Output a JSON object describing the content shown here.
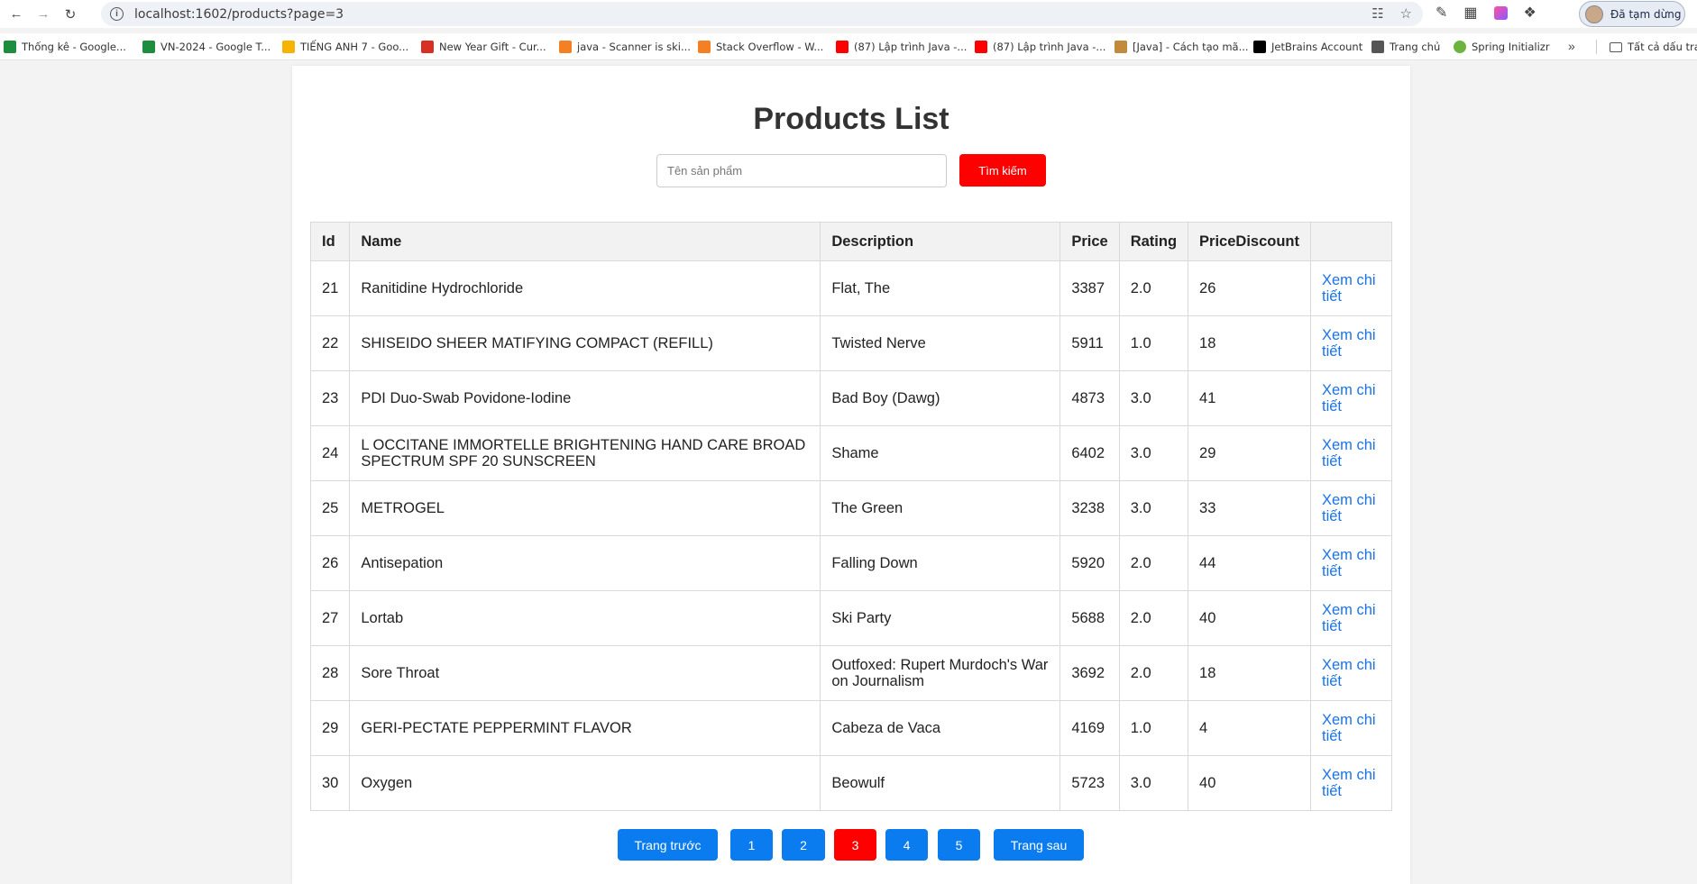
{
  "browser": {
    "url": "localhost:1602/products?page=3",
    "profile_label": "Đã tạm dừng",
    "bookmarks": [
      {
        "label": "Thống kê - Google...",
        "color": "#1e8e3e"
      },
      {
        "label": "VN-2024 - Google T...",
        "color": "#1e8e3e"
      },
      {
        "label": "TIẾNG ANH 7 - Goo...",
        "color": "#f4b400"
      },
      {
        "label": "New Year Gift - Cur...",
        "color": "#d93025"
      },
      {
        "label": "java - Scanner is ski...",
        "color": "#f48024"
      },
      {
        "label": "Stack Overflow - W...",
        "color": "#f48024"
      },
      {
        "label": "(87) Lập trình Java -...",
        "color": "#ff0000"
      },
      {
        "label": "(87) Lập trình Java -...",
        "color": "#ff0000"
      },
      {
        "label": "[Java] - Cách tạo mã...",
        "color": "#c28a3c"
      },
      {
        "label": "JetBrains Account",
        "color": "#000000"
      },
      {
        "label": "Trang chủ",
        "color": "#555555"
      },
      {
        "label": "Spring Initializr",
        "color": "#6db33f"
      }
    ],
    "folder_label": "Tất cả dấu tra"
  },
  "page": {
    "title": "Products List",
    "search_placeholder": "Tên sản phẩm",
    "search_button": "Tìm kiếm"
  },
  "table": {
    "headers": [
      "Id",
      "Name",
      "Description",
      "Price",
      "Rating",
      "PriceDiscount",
      ""
    ],
    "detail_label": "Xem chi tiết",
    "rows": [
      {
        "id": "21",
        "name": "Ranitidine Hydrochloride",
        "description": "Flat, The",
        "price": "3387",
        "rating": "2.0",
        "discount": "26"
      },
      {
        "id": "22",
        "name": "SHISEIDO SHEER MATIFYING COMPACT (REFILL)",
        "description": "Twisted Nerve",
        "price": "5911",
        "rating": "1.0",
        "discount": "18"
      },
      {
        "id": "23",
        "name": "PDI Duo-Swab Povidone-Iodine",
        "description": "Bad Boy (Dawg)",
        "price": "4873",
        "rating": "3.0",
        "discount": "41"
      },
      {
        "id": "24",
        "name": "L OCCITANE IMMORTELLE BRIGHTENING HAND CARE BROAD SPECTRUM SPF 20 SUNSCREEN",
        "description": "Shame",
        "price": "6402",
        "rating": "3.0",
        "discount": "29"
      },
      {
        "id": "25",
        "name": "METROGEL",
        "description": "The Green",
        "price": "3238",
        "rating": "3.0",
        "discount": "33"
      },
      {
        "id": "26",
        "name": "Antisepation",
        "description": "Falling Down",
        "price": "5920",
        "rating": "2.0",
        "discount": "44"
      },
      {
        "id": "27",
        "name": "Lortab",
        "description": "Ski Party",
        "price": "5688",
        "rating": "2.0",
        "discount": "40"
      },
      {
        "id": "28",
        "name": "Sore Throat",
        "description": "Outfoxed: Rupert Murdoch's War on Journalism",
        "price": "3692",
        "rating": "2.0",
        "discount": "18"
      },
      {
        "id": "29",
        "name": "GERI-PECTATE PEPPERMINT FLAVOR",
        "description": "Cabeza de Vaca",
        "price": "4169",
        "rating": "1.0",
        "discount": "4"
      },
      {
        "id": "30",
        "name": "Oxygen",
        "description": "Beowulf",
        "price": "5723",
        "rating": "3.0",
        "discount": "40"
      }
    ]
  },
  "pagination": {
    "prev_label": "Trang trước",
    "next_label": "Trang sau",
    "pages": [
      "1",
      "2",
      "3",
      "4",
      "5"
    ],
    "current": "3",
    "accent_color": "#0a7cf0",
    "active_color": "#ff0000"
  }
}
